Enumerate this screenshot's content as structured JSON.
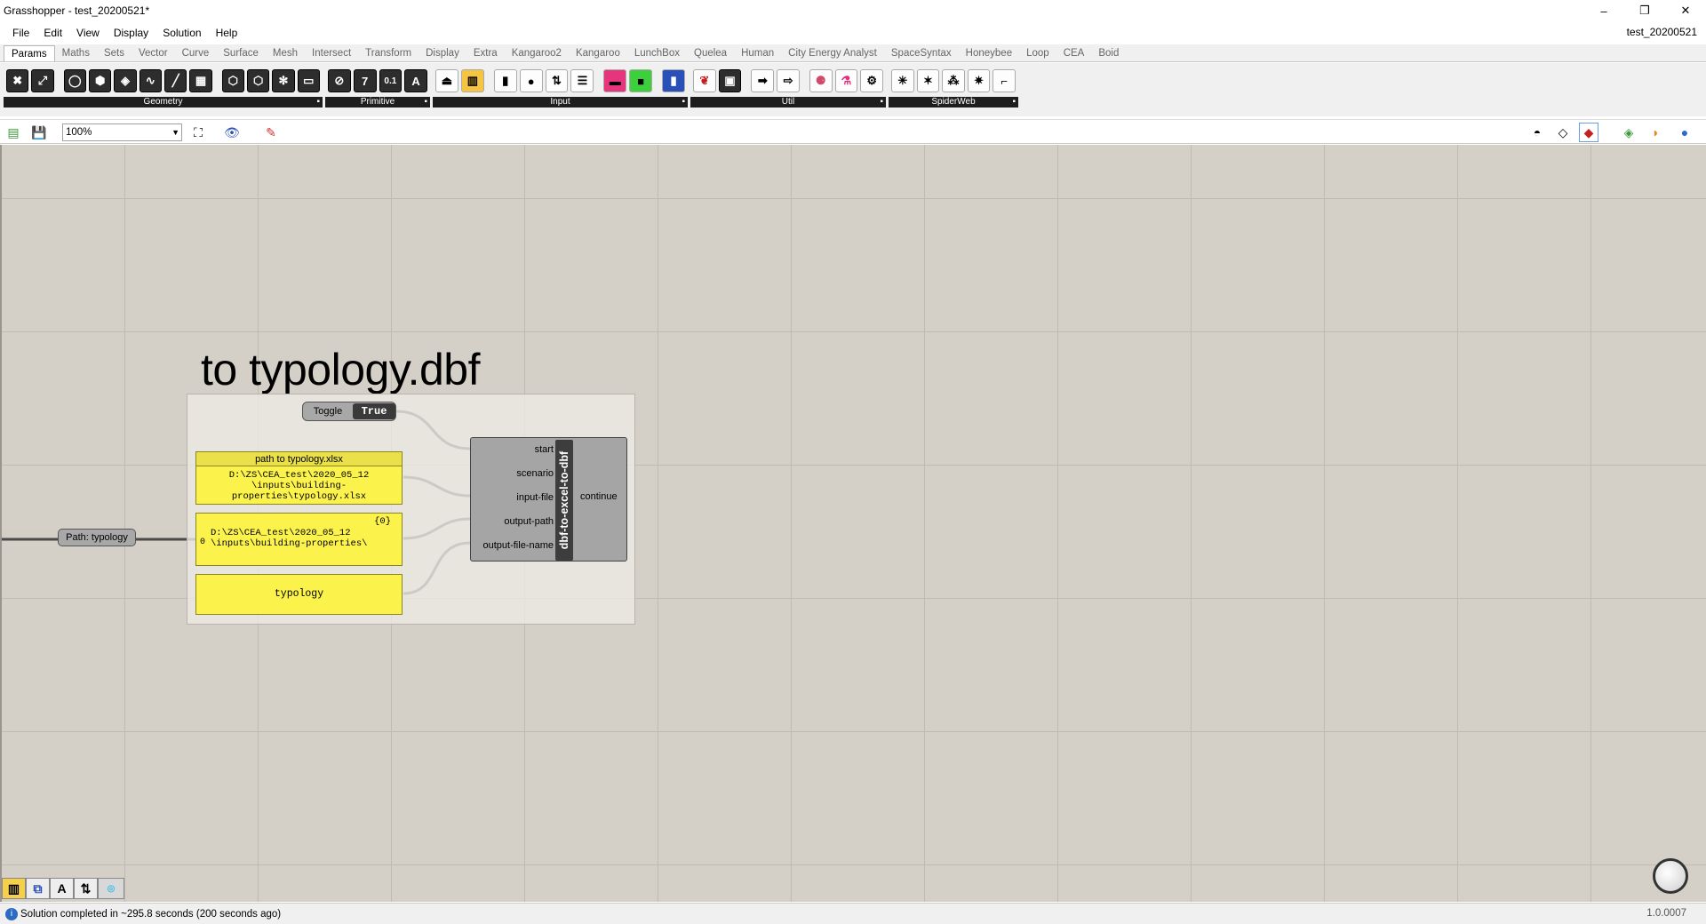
{
  "window": {
    "title": "Grasshopper - test_20200521*",
    "minimize": "–",
    "restore": "❐",
    "close": "✕"
  },
  "menu": {
    "items": [
      "File",
      "Edit",
      "View",
      "Display",
      "Solution",
      "Help"
    ],
    "doc_name": "test_20200521"
  },
  "tabs": [
    "Params",
    "Maths",
    "Sets",
    "Vector",
    "Curve",
    "Surface",
    "Mesh",
    "Intersect",
    "Transform",
    "Display",
    "Extra",
    "Kangaroo2",
    "Kangaroo",
    "LunchBox",
    "Quelea",
    "Human",
    "City Energy Analyst",
    "SpaceSyntax",
    "Honeybee",
    "Loop",
    "CEA",
    "Boid"
  ],
  "active_tab": "Params",
  "ribbon": {
    "groups": [
      {
        "label": "Geometry",
        "icons": [
          "geometry-icon",
          "geometry-pipeline-icon",
          "circle-param-icon",
          "box-param-icon",
          "brep-param-icon",
          "curve-param-icon",
          "line-param-icon",
          "mesh-param-icon",
          "surface-param-icon",
          "field-icon",
          "point-param-icon",
          "plane-param-icon",
          "vector-param-icon"
        ]
      },
      {
        "label": "Primitive",
        "icons": [
          "boolean-icon",
          "integer-icon",
          "number-icon",
          "text-icon"
        ],
        "glyphs": [
          "⊘",
          "7",
          "0.1",
          "A"
        ]
      },
      {
        "label": "Input",
        "icons": [
          "button-icon",
          "color-swatch-icon",
          "control-knob-icon",
          "digit-scroller-icon",
          "slider-icon",
          "gradient-icon",
          "graph-mapper-icon",
          "toggle-icon"
        ]
      },
      {
        "label": "Util",
        "icons": [
          "cherry-picker-icon",
          "cluster-icon",
          "data-dam-icon",
          "relay-icon",
          "jump-icon",
          "flask-icon",
          "bake-icon"
        ]
      },
      {
        "label": "SpiderWeb",
        "icons": [
          "spiderweb-1-icon",
          "spiderweb-2-icon",
          "spiderweb-3-icon",
          "spiderweb-4-icon",
          "spiderweb-5-icon"
        ]
      }
    ]
  },
  "toolbar": {
    "zoom": "100%"
  },
  "canvas": {
    "group_title": "to typology.dbf",
    "toggle": {
      "label": "Toggle",
      "value": "True"
    },
    "panel_xlsx": {
      "header": "path to typology.xlsx",
      "body": "D:\\ZS\\CEA_test\\2020_05_12\n\\inputs\\building-\nproperties\\typology.xlsx"
    },
    "panel_output": {
      "index": "{0}",
      "zero": "0",
      "body": "D:\\ZS\\CEA_test\\2020_05_12\n\\inputs\\building-properties\\"
    },
    "panel_name": {
      "body": "typology"
    },
    "path_param": "Path: typology",
    "component": {
      "name": "dbf-to-excel-to-dbf",
      "inputs": [
        "start",
        "scenario",
        "input-file",
        "output-path",
        "output-file-name"
      ],
      "output": "continue"
    }
  },
  "status": {
    "message": "Solution completed in ~295.8 seconds (200 seconds ago)",
    "version": "1.0.0007"
  }
}
